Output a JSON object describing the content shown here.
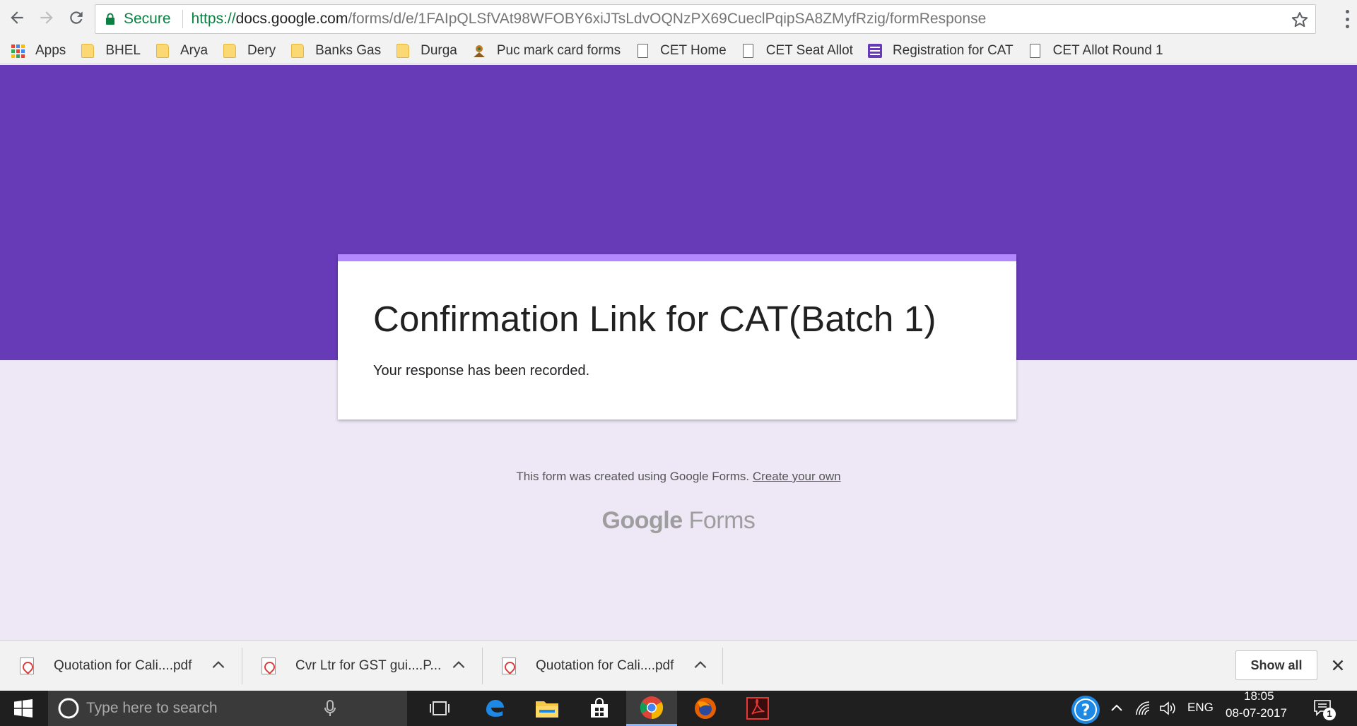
{
  "browser": {
    "secure_label": "Secure",
    "url_scheme": "https://",
    "url_host": "docs.google.com",
    "url_path": "/forms/d/e/1FAIpQLSfVAt98WFOBY6xiJTsLdvOQNzPX69CueclPqipSA8ZMyfRzig/formResponse"
  },
  "bookmarks": [
    {
      "label": "Apps",
      "icon": "apps-grid-icon"
    },
    {
      "label": "BHEL",
      "icon": "folder-icon"
    },
    {
      "label": "Arya",
      "icon": "folder-icon"
    },
    {
      "label": "Dery",
      "icon": "folder-icon"
    },
    {
      "label": "Banks Gas",
      "icon": "folder-icon"
    },
    {
      "label": "Durga",
      "icon": "folder-icon"
    },
    {
      "label": "Puc mark card forms",
      "icon": "emblem-icon"
    },
    {
      "label": "CET Home",
      "icon": "page-icon"
    },
    {
      "label": "CET Seat Allot",
      "icon": "page-icon"
    },
    {
      "label": "Registration for CAT",
      "icon": "google-forms-icon"
    },
    {
      "label": "CET Allot Round 1",
      "icon": "page-icon"
    }
  ],
  "form": {
    "title": "Confirmation Link for CAT(Batch 1)",
    "message": "Your response has been recorded.",
    "footer_text": "This form was created using Google Forms.",
    "footer_link": "Create your own",
    "logo_google": "Google",
    "logo_forms": "Forms"
  },
  "downloads": {
    "items": [
      {
        "name": "Quotation for Cali....pdf"
      },
      {
        "name": "Cvr Ltr for GST gui....P..."
      },
      {
        "name": "Quotation for Cali....pdf"
      }
    ],
    "show_all_label": "Show all"
  },
  "taskbar": {
    "search_placeholder": "Type here to search",
    "language": "ENG",
    "time": "18:05",
    "date": "08-07-2017",
    "notification_count": "1"
  },
  "colors": {
    "form_theme": "#673ab7",
    "form_accent": "#b388ff",
    "page_background": "#ede7f6"
  }
}
